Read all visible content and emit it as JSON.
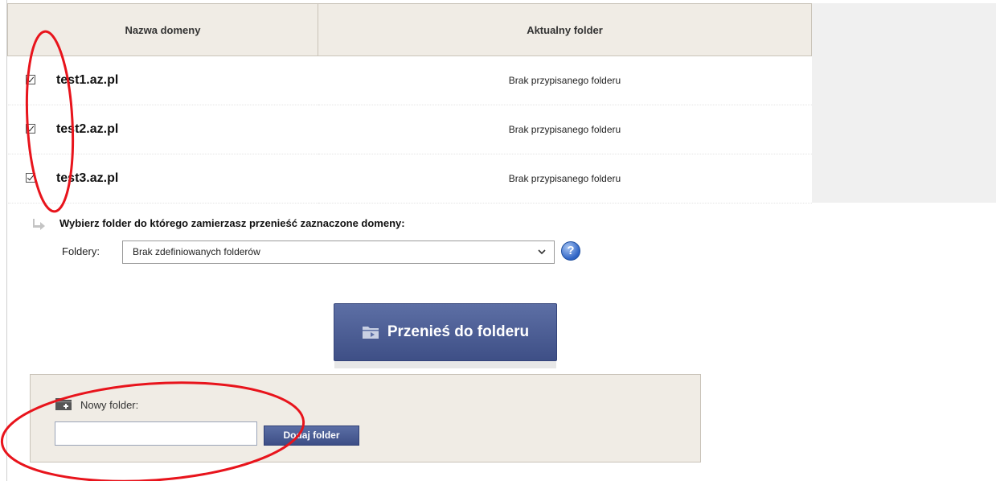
{
  "table": {
    "headers": [
      "Nazwa domeny",
      "Aktualny folder"
    ],
    "rows": [
      {
        "domain": "test1.az.pl",
        "folder": "Brak przypisanego folderu",
        "checked": true
      },
      {
        "domain": "test2.az.pl",
        "folder": "Brak przypisanego folderu",
        "checked": true
      },
      {
        "domain": "test3.az.pl",
        "folder": "Brak przypisanego folderu",
        "checked": true
      }
    ]
  },
  "move": {
    "prompt": "Wybierz folder do którego zamierzasz przenieść zaznaczone domeny:",
    "folders_label": "Foldery:",
    "folders_selected": "Brak zdefiniowanych folderów",
    "help_symbol": "?",
    "button_label": "Przenieś do folderu"
  },
  "new_folder": {
    "label": "Nowy folder:",
    "input_value": "",
    "button_label": "Dodaj folder"
  },
  "colors": {
    "button_blue": "#4a5b93",
    "panel_beige": "#f0ece5",
    "annotation_red": "#e8141c"
  },
  "icons": [
    "checkbox-icon",
    "arrow-right-icon",
    "chevron-down-icon",
    "help-icon",
    "folder-move-icon",
    "folder-add-icon"
  ]
}
